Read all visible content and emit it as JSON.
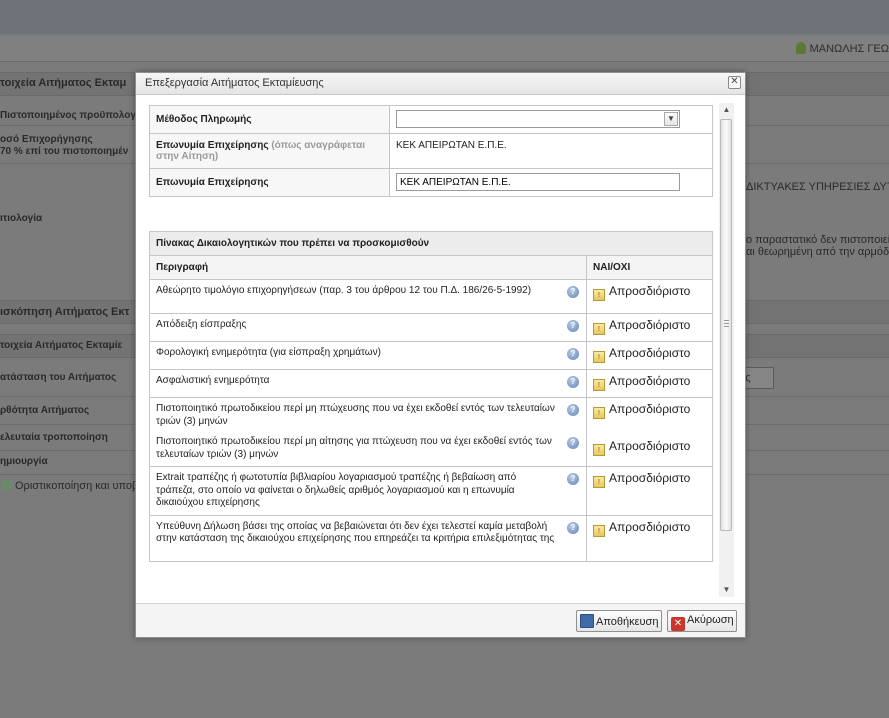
{
  "background": {
    "user_name": "ΜΑΝΩΛΗΣ ΓΕΩ",
    "labels": [
      "τοιχεία Αιτήματος Εκταμ",
      "Πιστοποιημένος προϋπολογι",
      "οσό Επιχορήγησης",
      "70 % επί του πιστοποιημέν",
      "ιτιολογία",
      "ισκόπηση Αιτήματος Εκτ",
      "τοιχεία Αιτήματος Εκταμίε",
      "ατάσταση του Αιτήματος",
      "ρθότητα Αιτήματος",
      "ελευταία τροποποίηση",
      "ημιουργία"
    ],
    "right_texts": [
      "ΔΙΚΤΥΑΚΕΣ ΥΠΗΡΕΣΙΕΣ ΔΥΤΙΚ",
      "ο παραστατικό δεν πιστοποιεί",
      "αι θεωρημένη από την αρμόδι"
    ],
    "small_button": "τος",
    "finalize_link": "Οριστικοποίηση και υποβ"
  },
  "dialog": {
    "title": "Επεξεργασία Αιτήματος Εκταμίευσης",
    "close_symbol": "✕",
    "form": {
      "payment_method_label": "Μέθοδος Πληρωμής",
      "payment_method_value": "",
      "company_name_app_label": "Επωνυμία Επιχείρησης",
      "company_name_app_hint": "(όπως αναγράφεται στην Αίτηση)",
      "company_name_app_value": "ΚΕΚ ΑΠΕΙΡΩΤΑΝ Ε.Π.Ε.",
      "company_name_label": "Επωνυμία Επιχείρησης",
      "company_name_value": "ΚΕΚ ΑΠΕΙΡΩΤΑΝ Ε.Π.Ε."
    },
    "docs": {
      "caption": "Πίνακας Δικαιολογητικών που πρέπει να προσκομισθούν",
      "col_desc": "Περιγραφή",
      "col_yesno": "ΝΑΙ/ΟΧΙ",
      "rows": [
        {
          "desc": "Αθεώρητο τιμολόγιο επιχορηγήσεων (παρ. 3 του άρθρου 12 του Π.Δ. 186/26-5-1992)",
          "status": "Απροσδιόριστο"
        },
        {
          "desc": "Απόδειξη είσπραξης",
          "status": "Απροσδιόριστο"
        },
        {
          "desc": "Φορολογική ενημερότητα (για είσπραξη χρημάτων)",
          "status": "Απροσδιόριστο"
        },
        {
          "desc": "Ασφαλιστική ενημερότητα",
          "status": "Απροσδιόριστο"
        },
        {
          "desc": "Πιστοποιητικό πρωτοδικείου περί μη πτώχευσης που να έχει εκδοθεί εντός των τελευταίων τριών (3) μηνών",
          "status": "Απροσδιόριστο",
          "merged_desc": "Πιστοποιητικό πρωτοδικείου περί μη αίτησης για πτώχευση που να έχει εκδοθεί εντός των τελευταίων τριών (3) μηνών"
        },
        {
          "desc": "Extrait τραπέζης ή φωτοτυπία βιβλιαρίου λογαριασμού τραπέζης ή βεβαίωση από τράπεζα, στο οποίο να φαίνεται ο δηλωθείς αριθμός λογαριασμού και η επωνυμία δικαιούχου επιχείρησης",
          "status": "Απροσδιόριστο"
        },
        {
          "desc": "Υπεύθυνη Δήλωση βάσει της οποίας να βεβαιώνεται ότι δεν έχει τελεστεί καμία μεταβολή στην κατάσταση της δικαιούχου επιχείρησης που επηρεάζει τα κριτήρια επιλεξιμότητας της",
          "status": "Απροσδιόριστο"
        }
      ]
    },
    "buttons": {
      "save": "Αποθήκευση",
      "cancel": "Ακύρωση"
    }
  }
}
